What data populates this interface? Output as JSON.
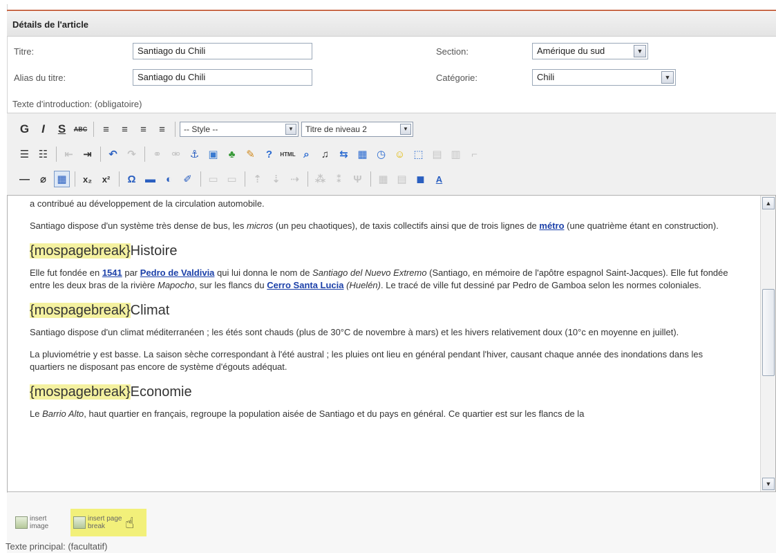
{
  "header": {
    "title": "Détails de l'article"
  },
  "form": {
    "titre_label": "Titre:",
    "titre_value": "Santiago du Chili",
    "alias_label": "Alias du titre:",
    "alias_value": "Santiago du Chili",
    "section_label": "Section:",
    "section_value": "Amérique du sud",
    "categorie_label": "Catégorie:",
    "categorie_value": "Chili",
    "intro_label": "Texte d'introduction: (obligatoire)"
  },
  "toolbar": {
    "bold": "G",
    "italic": "I",
    "underline": "S",
    "strike": "ABC",
    "style_select": "-- Style --",
    "heading_select": "Titre de niveau 2"
  },
  "editor": {
    "p_top": "a contribué au développement de la circulation automobile.",
    "p_bus_1": "Santiago dispose d'un système très dense de bus, les ",
    "p_bus_micros": "micros",
    "p_bus_2": " (un peu chaotiques), de taxis collectifs ainsi que de trois lignes de ",
    "p_bus_link": "métro",
    "p_bus_3": " (une quatrième étant en construction).",
    "pagebreak": "{mospagebreak}",
    "h_histoire": "Histoire",
    "p_hist_1": "Elle fut fondée en ",
    "p_hist_link1": "1541",
    "p_hist_2": " par ",
    "p_hist_link2": "Pedro de Valdivia",
    "p_hist_3": " qui lui donna le nom de ",
    "p_hist_it1": "Santiago del Nuevo Extremo",
    "p_hist_4": " (Santiago, en mémoire de l'apôtre espagnol Saint-Jacques). Elle fut fondée entre les deux bras de la rivière ",
    "p_hist_it2": "Mapocho",
    "p_hist_5": ", sur les flancs du ",
    "p_hist_link3": "Cerro Santa Lucia",
    "p_hist_it3": " (Huelén)",
    "p_hist_6": ". Le tracé de ville fut dessiné par Pedro de Gamboa selon les normes coloniales.",
    "h_climat": "Climat",
    "p_climat": "Santiago dispose d'un climat méditerranéen ; les étés sont chauds (plus de 30°C de novembre à mars) et les hivers relativement doux (10°c en moyenne en juillet).",
    "p_pluvio": "La pluviométrie y est basse. La saison sèche correspondant à l'été austral ; les pluies ont lieu en général pendant l'hiver, causant chaque année des inondations dans les quartiers ne disposant pas encore de système d'égouts adéquat.",
    "h_economie": "Economie",
    "p_eco_1": "Le ",
    "p_eco_it": "Barrio Alto",
    "p_eco_2": ", haut quartier en français, regroupe la population aisée de Santiago et du pays en général. Ce quartier est sur les flancs de la"
  },
  "bottom": {
    "insert_image": "insert image",
    "insert_pagebreak": "insert page break",
    "main_text_label": "Texte principal: (facultatif)"
  },
  "colors": {
    "accent_rule": "#c86a4a",
    "link": "#1a3fa8",
    "highlight": "#f4f1a0"
  }
}
